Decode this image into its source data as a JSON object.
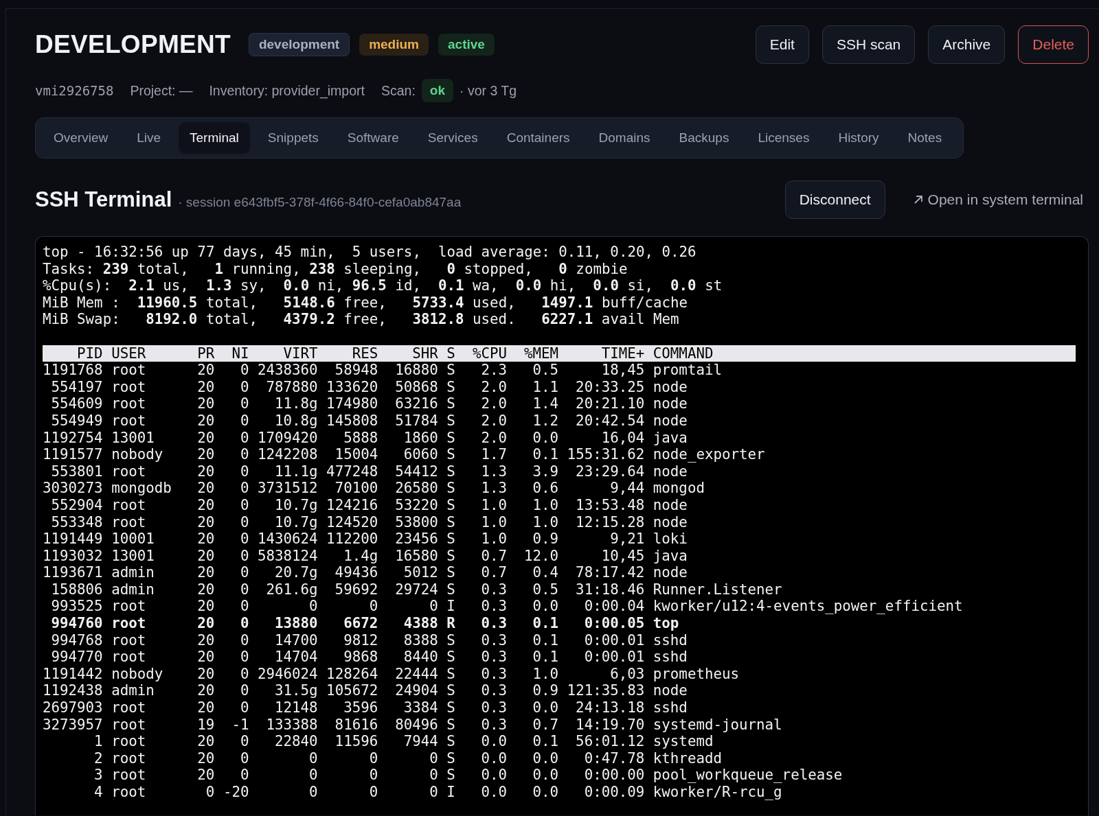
{
  "header": {
    "title": "DEVELOPMENT",
    "tags": [
      {
        "label": "development",
        "kind": "neutral"
      },
      {
        "label": "medium",
        "kind": "warning"
      },
      {
        "label": "active",
        "kind": "success"
      }
    ],
    "buttons": [
      {
        "label": "Edit",
        "kind": "default"
      },
      {
        "label": "SSH scan",
        "kind": "default"
      },
      {
        "label": "Archive",
        "kind": "default"
      },
      {
        "label": "Delete",
        "kind": "danger"
      }
    ]
  },
  "meta": {
    "host": "vmi2926758",
    "project": "Project: —",
    "inventory": "Inventory: provider_import",
    "scan_label": "Scan:",
    "scan_status": {
      "label": "ok",
      "kind": "success"
    },
    "scan_age": "· vor 3 Tg"
  },
  "tabs": [
    {
      "label": "Overview",
      "selected": false
    },
    {
      "label": "Live",
      "selected": false
    },
    {
      "label": "Terminal",
      "selected": true
    },
    {
      "label": "Snippets",
      "selected": false
    },
    {
      "label": "Software",
      "selected": false
    },
    {
      "label": "Services",
      "selected": false
    },
    {
      "label": "Containers",
      "selected": false
    },
    {
      "label": "Domains",
      "selected": false
    },
    {
      "label": "Backups",
      "selected": false
    },
    {
      "label": "Licenses",
      "selected": false
    },
    {
      "label": "History",
      "selected": false
    },
    {
      "label": "Notes",
      "selected": false
    }
  ],
  "terminal_section": {
    "title": "SSH Terminal",
    "session": "· session e643fbf5-378f-4f66-84f0-cefa0ab847aa",
    "disconnect": "Disconnect",
    "open_link": "Open in system terminal"
  },
  "terminal": {
    "summary": [
      "top - 16:32:56 up 77 days, 45 min,  5 users,  load average: 0.11, 0.20, 0.26",
      "Tasks: **239** total,   **1** running, **238** sleeping,   **0** stopped,   **0** zombie",
      "%Cpu(s):  **2.1** us,  **1.3** sy,  **0.0** ni, **96.5** id,  **0.1** wa,  **0.0** hi,  **0.0** si,  **0.0** st",
      "MiB Mem :  **11960.5** total,   **5148.6** free,   **5733.4** used,   **1497.1** buff/cache",
      "MiB Swap:   **8192.0** total,   **4379.2** free,   **3812.8** used.   **6227.1** avail Mem"
    ],
    "columns": [
      "PID",
      "USER",
      "PR",
      "NI",
      "VIRT",
      "RES",
      "SHR",
      "S",
      "%CPU",
      "%MEM",
      "TIME+",
      "COMMAND"
    ],
    "rows": [
      {
        "cells": [
          "1191768",
          "root",
          "20",
          "0",
          "2438360",
          "58948",
          "16880",
          "S",
          "2.3",
          "0.5",
          "18,45",
          "promtail"
        ],
        "highlighted": false
      },
      {
        "cells": [
          "554197",
          "root",
          "20",
          "0",
          "787880",
          "133620",
          "50868",
          "S",
          "2.0",
          "1.1",
          "20:33.25",
          "node"
        ],
        "highlighted": false
      },
      {
        "cells": [
          "554609",
          "root",
          "20",
          "0",
          "11.8g",
          "174980",
          "63216",
          "S",
          "2.0",
          "1.4",
          "20:21.10",
          "node"
        ],
        "highlighted": false
      },
      {
        "cells": [
          "554949",
          "root",
          "20",
          "0",
          "10.8g",
          "145808",
          "51784",
          "S",
          "2.0",
          "1.2",
          "20:42.54",
          "node"
        ],
        "highlighted": false
      },
      {
        "cells": [
          "1192754",
          "13001",
          "20",
          "0",
          "1709420",
          "5888",
          "1860",
          "S",
          "2.0",
          "0.0",
          "16,04",
          "java"
        ],
        "highlighted": false
      },
      {
        "cells": [
          "1191577",
          "nobody",
          "20",
          "0",
          "1242208",
          "15004",
          "6060",
          "S",
          "1.7",
          "0.1",
          "155:31.62",
          "node_exporter"
        ],
        "highlighted": false
      },
      {
        "cells": [
          "553801",
          "root",
          "20",
          "0",
          "11.1g",
          "477248",
          "54412",
          "S",
          "1.3",
          "3.9",
          "23:29.64",
          "node"
        ],
        "highlighted": false
      },
      {
        "cells": [
          "3030273",
          "mongodb",
          "20",
          "0",
          "3731512",
          "70100",
          "26580",
          "S",
          "1.3",
          "0.6",
          "9,44",
          "mongod"
        ],
        "highlighted": false
      },
      {
        "cells": [
          "552904",
          "root",
          "20",
          "0",
          "10.7g",
          "124216",
          "53220",
          "S",
          "1.0",
          "1.0",
          "13:53.48",
          "node"
        ],
        "highlighted": false
      },
      {
        "cells": [
          "553348",
          "root",
          "20",
          "0",
          "10.7g",
          "124520",
          "53800",
          "S",
          "1.0",
          "1.0",
          "12:15.28",
          "node"
        ],
        "highlighted": false
      },
      {
        "cells": [
          "1191449",
          "10001",
          "20",
          "0",
          "1430624",
          "112200",
          "23456",
          "S",
          "1.0",
          "0.9",
          "9,21",
          "loki"
        ],
        "highlighted": false
      },
      {
        "cells": [
          "1193032",
          "13001",
          "20",
          "0",
          "5838124",
          "1.4g",
          "16580",
          "S",
          "0.7",
          "12.0",
          "10,45",
          "java"
        ],
        "highlighted": false
      },
      {
        "cells": [
          "1193671",
          "admin",
          "20",
          "0",
          "20.7g",
          "49436",
          "5012",
          "S",
          "0.7",
          "0.4",
          "78:17.42",
          "node"
        ],
        "highlighted": false
      },
      {
        "cells": [
          "158806",
          "admin",
          "20",
          "0",
          "261.6g",
          "59692",
          "29724",
          "S",
          "0.3",
          "0.5",
          "31:18.46",
          "Runner.Listener"
        ],
        "highlighted": false
      },
      {
        "cells": [
          "993525",
          "root",
          "20",
          "0",
          "0",
          "0",
          "0",
          "I",
          "0.3",
          "0.0",
          "0:00.04",
          "kworker/u12:4-events_power_efficient"
        ],
        "highlighted": false
      },
      {
        "cells": [
          "994760",
          "root",
          "20",
          "0",
          "13880",
          "6672",
          "4388",
          "R",
          "0.3",
          "0.1",
          "0:00.05",
          "top"
        ],
        "highlighted": true
      },
      {
        "cells": [
          "994768",
          "root",
          "20",
          "0",
          "14700",
          "9812",
          "8388",
          "S",
          "0.3",
          "0.1",
          "0:00.01",
          "sshd"
        ],
        "highlighted": false
      },
      {
        "cells": [
          "994770",
          "root",
          "20",
          "0",
          "14704",
          "9868",
          "8440",
          "S",
          "0.3",
          "0.1",
          "0:00.01",
          "sshd"
        ],
        "highlighted": false
      },
      {
        "cells": [
          "1191442",
          "nobody",
          "20",
          "0",
          "2946024",
          "128264",
          "22444",
          "S",
          "0.3",
          "1.0",
          "6,03",
          "prometheus"
        ],
        "highlighted": false
      },
      {
        "cells": [
          "1192438",
          "admin",
          "20",
          "0",
          "31.5g",
          "105672",
          "24904",
          "S",
          "0.3",
          "0.9",
          "121:35.83",
          "node"
        ],
        "highlighted": false
      },
      {
        "cells": [
          "2697903",
          "root",
          "20",
          "0",
          "12148",
          "3596",
          "3384",
          "S",
          "0.3",
          "0.0",
          "24:13.18",
          "sshd"
        ],
        "highlighted": false
      },
      {
        "cells": [
          "3273957",
          "root",
          "19",
          "-1",
          "133388",
          "81616",
          "80496",
          "S",
          "0.3",
          "0.7",
          "14:19.70",
          "systemd-journal"
        ],
        "highlighted": false
      },
      {
        "cells": [
          "1",
          "root",
          "20",
          "0",
          "22840",
          "11596",
          "7944",
          "S",
          "0.0",
          "0.1",
          "56:01.12",
          "systemd"
        ],
        "highlighted": false
      },
      {
        "cells": [
          "2",
          "root",
          "20",
          "0",
          "0",
          "0",
          "0",
          "S",
          "0.0",
          "0.0",
          "0:47.78",
          "kthreadd"
        ],
        "highlighted": false
      },
      {
        "cells": [
          "3",
          "root",
          "20",
          "0",
          "0",
          "0",
          "0",
          "S",
          "0.0",
          "0.0",
          "0:00.00",
          "pool_workqueue_release"
        ],
        "highlighted": false
      },
      {
        "cells": [
          "4",
          "root",
          "0",
          "-20",
          "0",
          "0",
          "0",
          "I",
          "0.0",
          "0.0",
          "0:00.09",
          "kworker/R-rcu_g"
        ],
        "highlighted": false
      }
    ]
  }
}
